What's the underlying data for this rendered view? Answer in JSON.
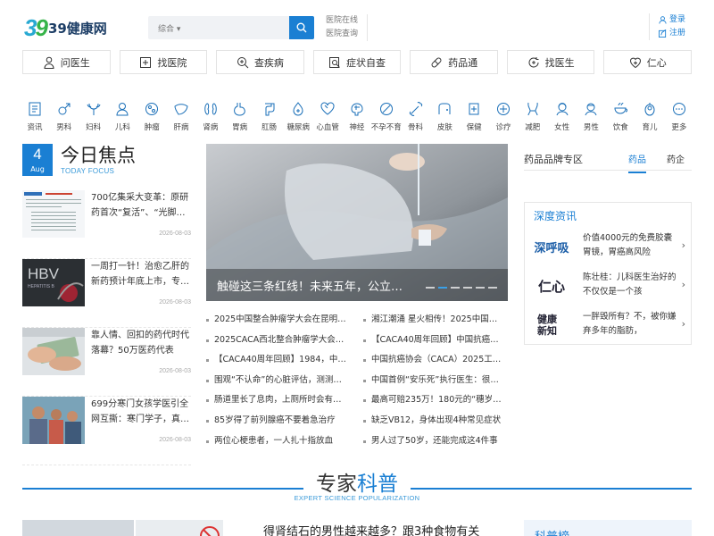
{
  "header": {
    "logo_mark_1": "3",
    "logo_mark_2": "9",
    "logo_text": "39健康网",
    "search_category": "综合 ▾",
    "quick_links": [
      "医院在线",
      "医院查询"
    ],
    "login": "登录",
    "register": "注册"
  },
  "nav": [
    {
      "label": "问医生",
      "icon": "doctor-icon"
    },
    {
      "label": "找医院",
      "icon": "hospital-icon"
    },
    {
      "label": "查疾病",
      "icon": "search-disease-icon"
    },
    {
      "label": "症状自查",
      "icon": "symptom-check-icon"
    },
    {
      "label": "药品通",
      "icon": "pill-icon"
    },
    {
      "label": "找医生",
      "icon": "find-doctor-icon"
    },
    {
      "label": "仁心",
      "icon": "heart-plus-icon"
    }
  ],
  "categories": [
    "资讯",
    "男科",
    "妇科",
    "儿科",
    "肿瘤",
    "肝病",
    "肾病",
    "胃病",
    "肛肠",
    "糖尿病",
    "心血管",
    "神经",
    "不孕不育",
    "骨科",
    "皮肤",
    "保健",
    "诊疗",
    "减肥",
    "女性",
    "男性",
    "饮食",
    "育儿",
    "更多"
  ],
  "focus": {
    "day": "4",
    "month": "Aug",
    "title": "今日焦点",
    "subtitle": "TODAY FOCUS",
    "news": [
      {
        "title": "700亿集采大变革：原研药首次“复活”、“光脚…",
        "date": "2026-08-03"
      },
      {
        "title": "一周打一针！治愈乙肝的新药预计年底上市，专…",
        "date": "2026-08-03"
      },
      {
        "title": "靠人情、回扣的药代时代落幕？50万医药代表正…",
        "date": "2026-08-03"
      },
      {
        "title": "699分寒门女孩学医引全网互撕：寒门学子，真…",
        "date": "2026-08-03"
      }
    ]
  },
  "hero": {
    "caption": "触碰这三条红线！未来五年，公立…"
  },
  "links": [
    "2025中国整合肿瘤学大会在昆明…",
    "湘江潮涌 星火相传！2025中国…",
    "2025CACA西北整合肿瘤学大会…",
    "【CACA40周年回顾】中国抗癌…",
    "【CACA40周年回顾】1984，中…",
    "中国抗癌协会（CACA）2025工…",
    "围观“不认命”的心脏评估，测测…",
    "中国首例“安乐死”执行医生：很…",
    "肠道里长了息肉，上厕所时会有…",
    "最高可赔235万！180元的“穗岁…",
    "85岁得了前列腺癌不要着急治疗",
    "缺乏VB12，身体出现4种常见症状",
    "两位心梗患者，一人扎十指放血",
    "男人过了50岁，还能完成这4件事"
  ],
  "brand": {
    "title": "药品品牌专区",
    "tab_active": "药品",
    "tab_other": "药企"
  },
  "deep": {
    "title": "深度资讯",
    "items": [
      {
        "logo": "深呼吸",
        "text": "价值4000元的免费胶囊胃镜，胃癌高风险"
      },
      {
        "logo": "仁心",
        "text": "陈壮桂：儿科医生治好的不仅仅是一个孩"
      },
      {
        "logo": "健康新知",
        "text": "一胖毁所有？不，被你嫌弃多年的脂肪，"
      }
    ]
  },
  "expert": {
    "title_a": "专家",
    "title_b": "科普",
    "subtitle": "EXPERT SCIENCE POPULARIZATION",
    "headline": "得肾结石的男性越来越多？跟3种食物有关",
    "side_title": "科普榜"
  },
  "colors": {
    "accent": "#1a7fd3",
    "logo_blue": "#28a9d2",
    "logo_green": "#35b348"
  }
}
